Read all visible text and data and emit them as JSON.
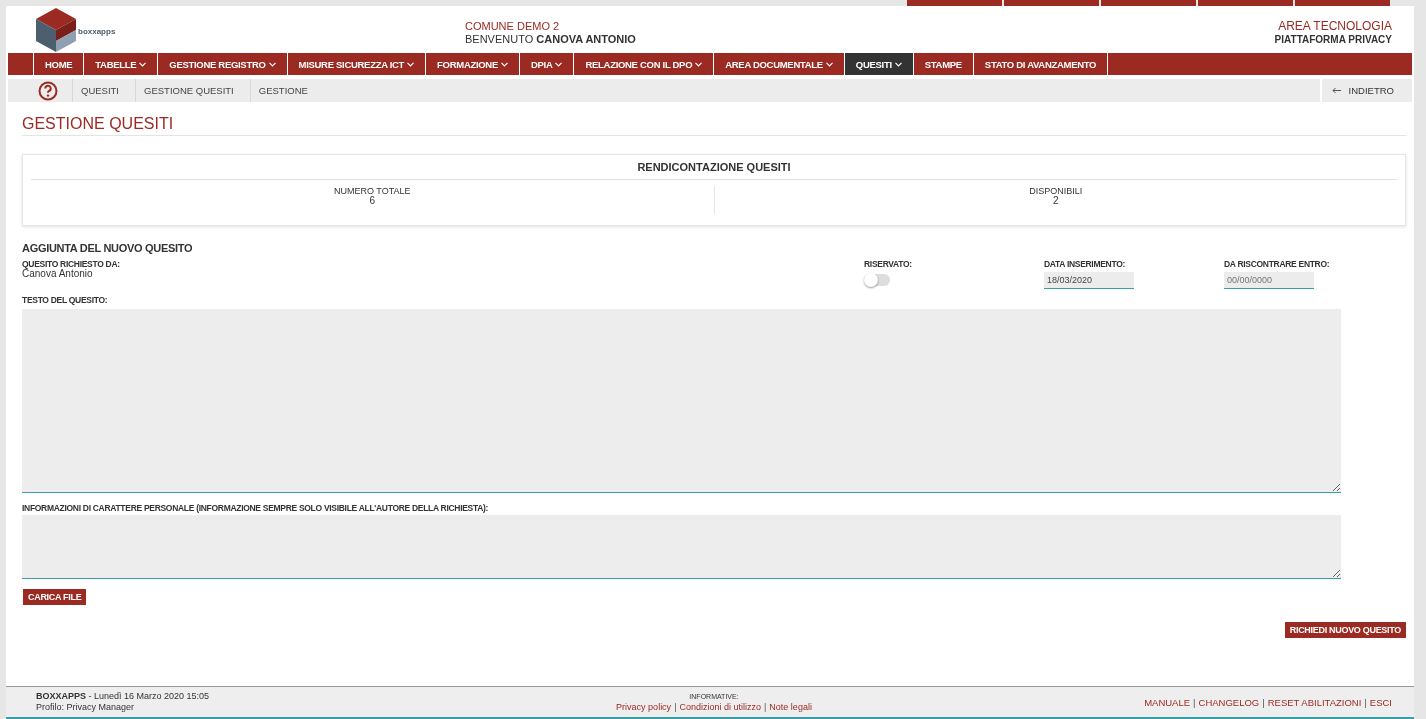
{
  "header": {
    "logo_text": "boxxapps",
    "organization": "COMUNE DEMO 2",
    "welcome_prefix": "BENVENUTO",
    "user": "CANOVA ANTONIO",
    "area": "AREA TECNOLOGIA",
    "platform": "PIATTAFORMA PRIVACY"
  },
  "nav": [
    {
      "label": "HOME",
      "selected": false,
      "dropdown": false
    },
    {
      "label": "TABELLE",
      "selected": false,
      "dropdown": true
    },
    {
      "label": "GESTIONE REGISTRO",
      "selected": false,
      "dropdown": true
    },
    {
      "label": "MISURE SICUREZZA ICT",
      "selected": false,
      "dropdown": true
    },
    {
      "label": "FORMAZIONE",
      "selected": false,
      "dropdown": true
    },
    {
      "label": "DPIA",
      "selected": false,
      "dropdown": true
    },
    {
      "label": "RELAZIONE CON IL DPO",
      "selected": false,
      "dropdown": true
    },
    {
      "label": "AREA DOCUMENTALE",
      "selected": false,
      "dropdown": true
    },
    {
      "label": "QUESITI",
      "selected": true,
      "dropdown": true
    },
    {
      "label": "STAMPE",
      "selected": false,
      "dropdown": false
    },
    {
      "label": "STATO DI AVANZAMENTO",
      "selected": false,
      "dropdown": false
    }
  ],
  "breadcrumb": [
    "QUESITI",
    "GESTIONE QUESITI",
    "GESTIONE"
  ],
  "back_link": "INDIETRO",
  "page_title": "GESTIONE QUESITI",
  "summary": {
    "title": "RENDICONTAZIONE QUESITI",
    "stats": [
      {
        "label": "NUMERO TOTALE",
        "value": "6"
      },
      {
        "label": "DISPONIBILI",
        "value": "2"
      }
    ]
  },
  "form": {
    "title": "AGGIUNTA DEL NUOVO QUESITO",
    "requester_label": "QUESITO RICHIESTO DA:",
    "requester": "Canova Antonio",
    "reserved": {
      "label": "RISERVATO:",
      "checked": false
    },
    "insert_date": {
      "label": "DATA INSERIMENTO:",
      "value": "18/03/2020"
    },
    "due_date": {
      "label": "DA RISCONTRARE ENTRO:",
      "placeholder": "00/00/0000"
    },
    "question_label": "TESTO DEL QUESITO:",
    "personal_label": "INFORMAZIONI DI CARATTERE PERSONALE (INFORMAZIONE SEMPRE SOLO VISIBILE ALL'AUTORE DELLA RICHIESTA):",
    "upload_button": "CARICA FILE",
    "submit_button": "RICHIEDI NUOVO QUESITO"
  },
  "footer": {
    "separator": "|",
    "brand": "BOXXAPPS",
    "datetime": "- Lunedì 16 Marzo 2020 15:05",
    "profile": "Profilo: Privacy Manager",
    "info_label": "INFORMATIVE:",
    "info_links": [
      "Privacy policy",
      "Condizioni di utilizzo",
      "Note legali"
    ],
    "links": [
      "MANUALE",
      "CHANGELOG",
      "RESET ABILITAZIONI",
      "ESCI"
    ]
  }
}
